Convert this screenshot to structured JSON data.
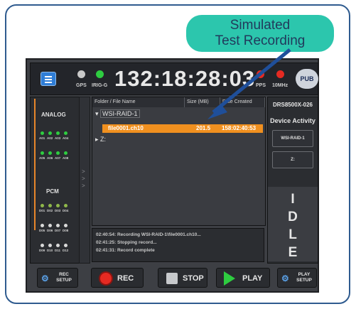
{
  "callout": {
    "line1": "Simulated",
    "line2": "Test Recording"
  },
  "topbar": {
    "gps_label": "GPS",
    "irig_label": "IRIG-G",
    "clock": "132:18:28:03",
    "pps_label": "PPS",
    "mhz_label": "10MHz",
    "pub_label": "PUB",
    "colors": {
      "gps_indicator": "#c8c8c8",
      "irig_indicator": "#2ecc40",
      "pps_indicator": "#e52a22",
      "mhz_indicator": "#e52a22"
    }
  },
  "left": {
    "analog_title": "ANALOG",
    "analog_channels": [
      "A01",
      "A02",
      "A03",
      "A04",
      "A05",
      "A06",
      "A07",
      "A08"
    ],
    "pcm_title": "PCM",
    "pcm_channels": [
      "D01",
      "D02",
      "D03",
      "D04",
      "D05",
      "D06",
      "D07",
      "D08",
      "D09",
      "D10",
      "D11",
      "D12"
    ],
    "arrows": ">  >  >"
  },
  "files": {
    "headers": {
      "name": "Folder / File Name",
      "size": "Size (MB)",
      "date": "Date Created"
    },
    "raid_folder": "WSI-RAID-1",
    "selected_file": {
      "name": "file0001.ch10",
      "size": "201.5",
      "date": "158:02:40:53"
    },
    "z_folder": "Z:"
  },
  "log": [
    "02:40:54: Recording WSI-RAID-1\\file0001.ch10...",
    "02:41:25: Stopping record...",
    "02:41:31: Record complete"
  ],
  "right": {
    "model": "DRS8500X-026",
    "device_activity": "Device Activity",
    "devices": [
      "WSI-RAID-1",
      "Z:"
    ],
    "status": "IDLE"
  },
  "bottom": {
    "rec_setup_1": "REC",
    "rec_setup_2": "SETUP",
    "rec": "REC",
    "stop": "STOP",
    "play": "PLAY",
    "play_setup_1": "PLAY",
    "play_setup_2": "SETUP"
  }
}
